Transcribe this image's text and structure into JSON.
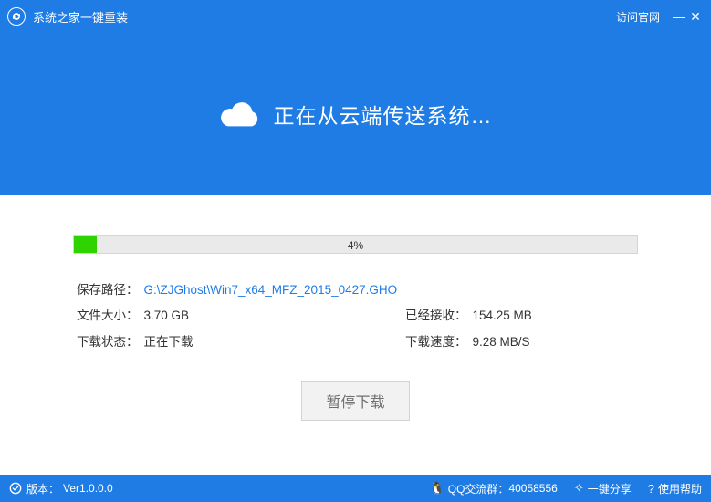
{
  "titlebar": {
    "app_name": "系统之家一键重装",
    "visit_site": "访问官网",
    "minimize": "—",
    "close": "✕"
  },
  "hero": {
    "text": "正在从云端传送系统…"
  },
  "progress": {
    "percent_label": "4%",
    "percent_value": 4
  },
  "info": {
    "save_path_label": "保存路径：",
    "save_path_value": "G:\\ZJGhost\\Win7_x64_MFZ_2015_0427.GHO",
    "file_size_label": "文件大小：",
    "file_size_value": "3.70 GB",
    "received_label": "已经接收：",
    "received_value": "154.25 MB",
    "status_label": "下载状态：",
    "status_value": "正在下载",
    "speed_label": "下载速度：",
    "speed_value": "9.28 MB/S"
  },
  "buttons": {
    "pause": "暂停下载"
  },
  "statusbar": {
    "version_label": "版本：",
    "version_value": "Ver1.0.0.0",
    "qq_label": "QQ交流群：",
    "qq_value": "40058556",
    "share": "一键分享",
    "help": "使用帮助"
  }
}
